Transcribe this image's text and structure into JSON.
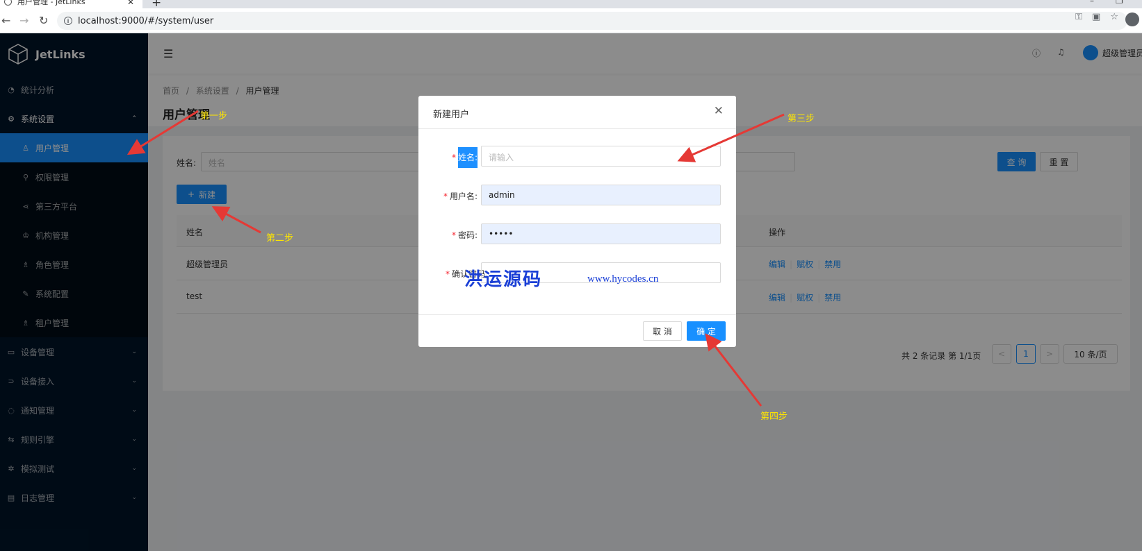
{
  "browser": {
    "tab_title": "用户管理 - JetLinks",
    "tab_close": "✕",
    "new_tab": "+",
    "url": "localhost:9000/#/system/user"
  },
  "sidebar": {
    "logo_text": "JetLinks",
    "items": [
      {
        "label": "统计分析",
        "icon": "dashboard-icon"
      },
      {
        "label": "系统设置",
        "icon": "setting-icon"
      },
      {
        "label": "用户管理",
        "icon": "user-icon"
      },
      {
        "label": "权限管理",
        "icon": "key-icon"
      },
      {
        "label": "第三方平台",
        "icon": "share-icon"
      },
      {
        "label": "机构管理",
        "icon": "org-icon"
      },
      {
        "label": "角色管理",
        "icon": "role-icon"
      },
      {
        "label": "系统配置",
        "icon": "tool-icon"
      },
      {
        "label": "租户管理",
        "icon": "tenant-icon"
      },
      {
        "label": "设备管理",
        "icon": "device-icon"
      },
      {
        "label": "设备接入",
        "icon": "plug-icon"
      },
      {
        "label": "通知管理",
        "icon": "message-icon"
      },
      {
        "label": "规则引擎",
        "icon": "swap-icon"
      },
      {
        "label": "模拟测试",
        "icon": "bug-icon"
      },
      {
        "label": "日志管理",
        "icon": "calendar-icon"
      }
    ]
  },
  "header": {
    "user_name": "超级管理员"
  },
  "page": {
    "breadcrumb": [
      "首页",
      "系统设置",
      "用户管理"
    ],
    "breadcrumb_sep": "/",
    "title": "用户管理",
    "search_label": "姓名:",
    "search_placeholder": "姓名",
    "query_button": "查 询",
    "reset_button": "重 置",
    "new_button": "新建",
    "columns": [
      "姓名",
      "操作"
    ],
    "rows": [
      {
        "name": "超级管理员",
        "actions": [
          "编辑",
          "赋权",
          "禁用"
        ]
      },
      {
        "name": "test",
        "actions": [
          "编辑",
          "赋权",
          "禁用"
        ]
      }
    ],
    "pager": {
      "summary": "共 2 条记录 第 1/1页",
      "prev": "<",
      "current": "1",
      "next": ">",
      "page_size": "10 条/页"
    }
  },
  "modal": {
    "title": "新建用户",
    "close": "✕",
    "fields": [
      {
        "label": "姓名:",
        "value": "",
        "placeholder": "请输入"
      },
      {
        "label": "用户名:",
        "value": "admin"
      },
      {
        "label": "密码:",
        "value": "•••••"
      },
      {
        "label": "确认密码:",
        "value": ""
      }
    ],
    "required_mark": "*",
    "cancel": "取 消",
    "ok": "确 定",
    "watermark_cn": "洪运源码",
    "watermark_url": "www.hycodes.cn"
  },
  "annotations": [
    "第一步",
    "第二步",
    "第三步",
    "第四步"
  ],
  "colors": {
    "primary": "#1890ff",
    "sidebar": "#001529",
    "annotation": "#ffe600",
    "arrow": "#e53935"
  }
}
